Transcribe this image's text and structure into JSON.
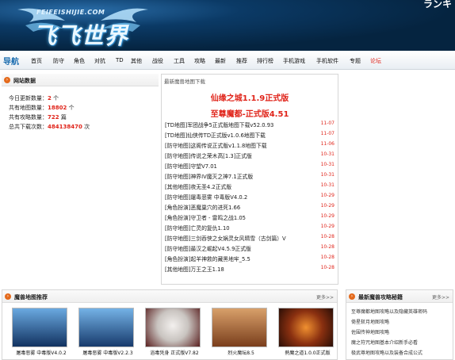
{
  "header": {
    "logo_url_text": "FEIFEISHIJIE.COM",
    "logo_main_text": "飞飞世界",
    "corner_text": "ランキ"
  },
  "nav": {
    "guide_label": "导航",
    "items": [
      "首页",
      "防守",
      "角色",
      "对抗",
      "TD",
      "其他",
      "战役",
      "工具",
      "攻略",
      "最新",
      "推荐",
      "排行榜",
      "手机游戏",
      "手机软件",
      "专题",
      "论坛"
    ]
  },
  "site_stats": {
    "title": "网站数据",
    "rows": [
      {
        "label": "今日更新数量：",
        "value": "2",
        "unit": " 个"
      },
      {
        "label": "共有地图数量：",
        "value": "18802",
        "unit": " 个"
      },
      {
        "label": "共有攻略数量：",
        "value": "722",
        "unit": " 篇"
      },
      {
        "label": "总共下载次数：",
        "value": "484138470",
        "unit": " 次"
      }
    ]
  },
  "latest_maps": {
    "title": "最新魔兽地图下载",
    "featured": [
      "仙缘之城1.1.9正式版",
      "至尊魔都-正式版4.51"
    ],
    "items": [
      {
        "title": "[TD地图]军团战争5正式版地图下载v52.0.93",
        "date": "11-07"
      },
      {
        "title": "[TD地图]仙侠传TD正式版v1.0.6地图下载",
        "date": "11-07"
      },
      {
        "title": "[防守地图]这阁传说正式版v1.1.8地图下载",
        "date": "11-06"
      },
      {
        "title": "[防守地图]传说之荣木高[1.3]正式版",
        "date": "10-31"
      },
      {
        "title": "[防守地图]守望V7.01",
        "date": "10-31"
      },
      {
        "title": "[防守地图]神界IV魔灭之神7.1正式版",
        "date": "10-31"
      },
      {
        "title": "[其他地图]夜无圣4.2正式版",
        "date": "10-31"
      },
      {
        "title": "[防守地图]屠毒恶雾 中毒版V4.0.2",
        "date": "10-29"
      },
      {
        "title": "[角色扮演]恶魔巢穴的进死1.66",
        "date": "10-29"
      },
      {
        "title": "[角色扮演]守卫者 - 雷鸣之战1.05",
        "date": "10-29"
      },
      {
        "title": "[防守地图]亡灵的复仇1.10",
        "date": "10-29"
      },
      {
        "title": "[防守地图]三剑吞侠之女娲灵女风晴雪（古剑篇）V",
        "date": "10-28"
      },
      {
        "title": "[防守地图]最汉之崛起V4.5.9正式版",
        "date": "10-28"
      },
      {
        "title": "[角色扮演]起羊神救的藏黑地牢_5.5",
        "date": "10-28"
      },
      {
        "title": "[其他地图]万王之王1.18",
        "date": "10-28"
      }
    ]
  },
  "recommended": {
    "title": "魔兽地图推荐",
    "more": "更多>>",
    "thumbs": [
      {
        "caption": "屠毒恶雾 中毒版V4.0.2",
        "color": "#1d3a6e"
      },
      {
        "caption": "屠毒恶雾 中毒版V2.2.3",
        "color": "#223f78"
      },
      {
        "caption": "浴毒凭身 正式版V7.82",
        "color": "#d9d4d0"
      },
      {
        "caption": "烈火魔坛8.5",
        "color": "#a85a2c"
      },
      {
        "caption": "熱魔之道1.0.0正式版",
        "color": "#6b2d14"
      }
    ]
  },
  "guides": {
    "title": "最新魔兽攻略秘籍",
    "more": "更多>>",
    "items": [
      "至尊魔都地图攻略以及隐藏英雄密码",
      "倚星斩月地图攻略",
      "佐围传神地图攻略",
      "魔之符咒地图基本介绍新手必看",
      "极武尊地图攻略以及装备合成公式"
    ]
  }
}
